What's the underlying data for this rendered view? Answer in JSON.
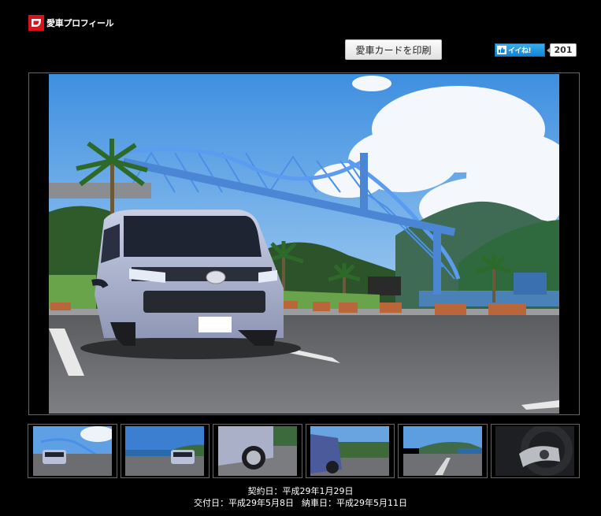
{
  "header": {
    "logo_text": "愛車プロフィール",
    "print_button": "愛車カードを印刷",
    "like_label": "イイね!",
    "like_count": "201"
  },
  "thumbnails": [
    {
      "name": "thumb-bridge-car"
    },
    {
      "name": "thumb-coast-car"
    },
    {
      "name": "thumb-wheel-closeup"
    },
    {
      "name": "thumb-side-view"
    },
    {
      "name": "thumb-ocean-road"
    },
    {
      "name": "thumb-steering-wheel"
    }
  ],
  "dates": {
    "contract_label": "契約日：",
    "contract_date": "平成29年1月29日",
    "delivery_label": "交付日：",
    "delivery_date": "平成29年5月8日",
    "handover_label": "納車日：",
    "handover_date": "平成29年5月11日"
  },
  "colors": {
    "brand_red": "#d7131d",
    "like_blue": "#1484cf"
  },
  "icons": {
    "logo": "daihatsu-logo-icon",
    "like": "like-icon"
  }
}
